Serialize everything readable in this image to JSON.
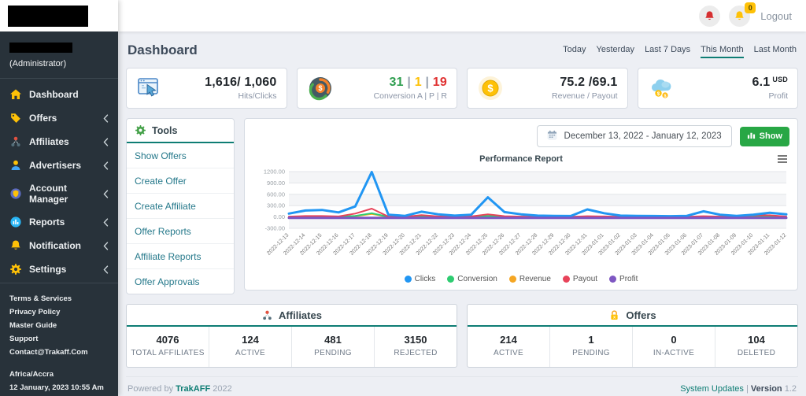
{
  "accent_teal": "#0e7d74",
  "sidebar": {
    "user": {
      "role": "(Administrator)"
    },
    "items": [
      {
        "label": "Dashboard",
        "icon": "home",
        "has_submenu": false
      },
      {
        "label": "Offers",
        "icon": "tag",
        "has_submenu": true
      },
      {
        "label": "Affiliates",
        "icon": "network",
        "has_submenu": true
      },
      {
        "label": "Advertisers",
        "icon": "person",
        "has_submenu": true
      },
      {
        "label": "Account Manager",
        "icon": "shield",
        "has_submenu": true
      },
      {
        "label": "Reports",
        "icon": "chart-circle",
        "has_submenu": true
      },
      {
        "label": "Notification",
        "icon": "bell",
        "has_submenu": true
      },
      {
        "label": "Settings",
        "icon": "gear",
        "has_submenu": true
      }
    ],
    "footer_links": [
      "Terms & Services",
      "Privacy Policy",
      "Master Guide",
      "Support",
      "Contact@Trakaff.Com"
    ],
    "timezone": "Africa/Accra",
    "datetime": "12 January, 2023 10:55 Am"
  },
  "topbar": {
    "logout_label": "Logout",
    "notification_badge": "0"
  },
  "page": {
    "title": "Dashboard",
    "filters": [
      {
        "label": "Today",
        "active": false
      },
      {
        "label": "Yesterday",
        "active": false
      },
      {
        "label": "Last 7 Days",
        "active": false
      },
      {
        "label": "This Month",
        "active": true
      },
      {
        "label": "Last Month",
        "active": false
      }
    ]
  },
  "stat_cards": [
    {
      "icon": "browser-cursor",
      "value": "1,616/ 1,060",
      "label": "Hits/Clicks"
    },
    {
      "icon": "conversion-gauge",
      "value_parts": [
        {
          "text": "31",
          "color": "#2e9e4f"
        },
        {
          "text": " | ",
          "color": "#9aa4b2"
        },
        {
          "text": "1",
          "color": "#fec107"
        },
        {
          "text": " | ",
          "color": "#9aa4b2"
        },
        {
          "text": "19",
          "color": "#e03131"
        }
      ],
      "label": "Conversion A | P | R"
    },
    {
      "icon": "dollar-coin",
      "value": "75.2 /69.1",
      "label": "Revenue / Payout"
    },
    {
      "icon": "cloud-coins",
      "value": "6.1",
      "value_suffix": "USD",
      "label": "Profit"
    }
  ],
  "tools": {
    "title": "Tools",
    "links": [
      "Show Offers",
      "Create Offer",
      "Create Affiliate",
      "Offer Reports",
      "Affiliate Reports",
      "Offer Approvals"
    ]
  },
  "chart_panel": {
    "date_range": "December 13, 2022 - January 12, 2023",
    "show_button": "Show",
    "title": "Performance Report"
  },
  "chart_data": {
    "type": "line",
    "title": "Performance Report",
    "xlabel": "",
    "ylabel": "",
    "ylim": [
      -300,
      1200
    ],
    "ytick_step": 300,
    "grid": true,
    "legend_position": "bottom",
    "categories": [
      "2022-12-13",
      "2022-12-14",
      "2022-12-15",
      "2022-12-16",
      "2022-12-17",
      "2022-12-18",
      "2022-12-19",
      "2022-12-20",
      "2022-12-21",
      "2022-12-22",
      "2022-12-23",
      "2022-12-24",
      "2022-12-25",
      "2022-12-26",
      "2022-12-27",
      "2022-12-28",
      "2022-12-29",
      "2022-12-30",
      "2022-12-31",
      "2023-01-01",
      "2023-01-02",
      "2023-01-03",
      "2023-01-04",
      "2023-01-05",
      "2023-01-06",
      "2023-01-07",
      "2023-01-08",
      "2023-01-09",
      "2023-01-10",
      "2023-01-11",
      "2023-01-12"
    ],
    "series": [
      {
        "name": "Clicks",
        "color": "#2196f3",
        "width": 3,
        "values": [
          90,
          170,
          185,
          120,
          280,
          1190,
          60,
          30,
          140,
          70,
          35,
          60,
          520,
          130,
          70,
          35,
          30,
          25,
          200,
          100,
          35,
          30,
          25,
          20,
          30,
          150,
          60,
          30,
          60,
          110,
          70
        ]
      },
      {
        "name": "Conversion",
        "color": "#2ecc71",
        "width": 2,
        "values": [
          5,
          10,
          10,
          5,
          30,
          100,
          5,
          3,
          10,
          5,
          3,
          5,
          30,
          8,
          5,
          3,
          3,
          3,
          8,
          5,
          3,
          3,
          3,
          3,
          3,
          8,
          5,
          3,
          5,
          8,
          5
        ]
      },
      {
        "name": "Revenue",
        "color": "#f5a623",
        "width": 2,
        "values": [
          3,
          8,
          8,
          5,
          20,
          80,
          4,
          2,
          8,
          4,
          2,
          4,
          25,
          6,
          4,
          2,
          2,
          2,
          6,
          4,
          2,
          2,
          2,
          2,
          2,
          6,
          4,
          2,
          10,
          12,
          4
        ]
      },
      {
        "name": "Payout",
        "color": "#e8435a",
        "width": 2,
        "values": [
          10,
          25,
          25,
          15,
          90,
          220,
          10,
          5,
          50,
          15,
          8,
          15,
          70,
          20,
          10,
          5,
          5,
          5,
          20,
          15,
          5,
          5,
          5,
          5,
          5,
          20,
          10,
          5,
          40,
          45,
          10
        ]
      },
      {
        "name": "Profit",
        "color": "#7e57c2",
        "width": 3,
        "values": [
          -25,
          -25,
          -25,
          -25,
          -25,
          -25,
          -25,
          -25,
          -25,
          -25,
          -25,
          -25,
          -25,
          -25,
          -25,
          -25,
          -25,
          -25,
          -25,
          -25,
          -25,
          -25,
          -25,
          -25,
          -25,
          -25,
          -25,
          -25,
          -25,
          -25,
          -25
        ]
      }
    ]
  },
  "affiliates_panel": {
    "title": "Affiliates",
    "stats": [
      {
        "value": "4076",
        "label": "TOTAL AFFILIATES"
      },
      {
        "value": "124",
        "label": "ACTIVE"
      },
      {
        "value": "481",
        "label": "PENDING"
      },
      {
        "value": "3150",
        "label": "REJECTED"
      }
    ]
  },
  "offers_panel": {
    "title": "Offers",
    "stats": [
      {
        "value": "214",
        "label": "ACTIVE"
      },
      {
        "value": "1",
        "label": "PENDING"
      },
      {
        "value": "0",
        "label": "IN-ACTIVE"
      },
      {
        "value": "104",
        "label": "DELETED"
      }
    ]
  },
  "footer": {
    "powered_prefix": "Powered by",
    "brand": "TrakAFF",
    "year": "2022",
    "system_updates": "System Updates",
    "separator": "|",
    "version_label": "Version",
    "version_value": "1.2"
  }
}
